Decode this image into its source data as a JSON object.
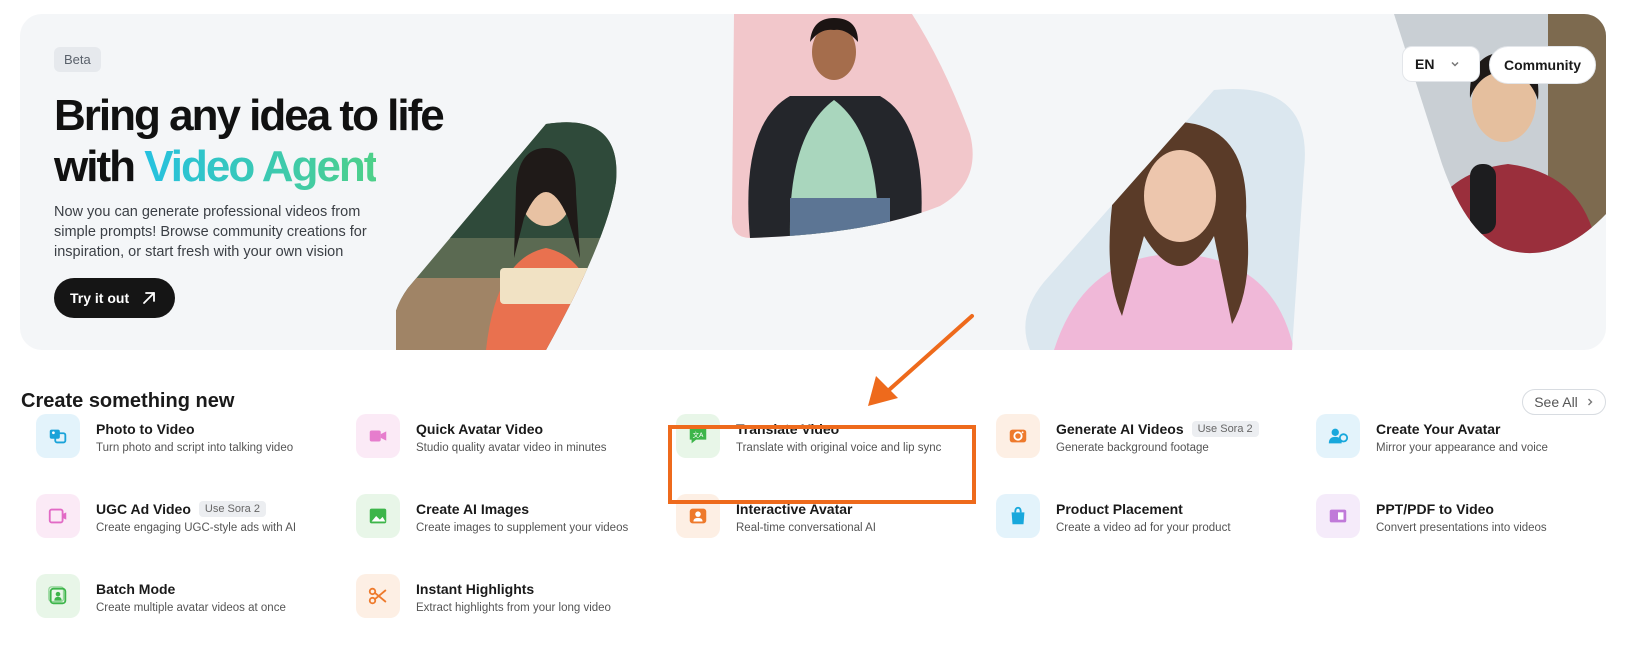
{
  "hero": {
    "badge": "Beta",
    "headline_line1": "Bring any idea to life",
    "headline_line2_prefix": "with ",
    "headline_line2_accent": "Video Agent",
    "description": "Now you can generate professional videos from simple prompts! Browse community creations for inspiration, or start fresh with your own vision",
    "cta_label": "Try it out"
  },
  "header": {
    "language": "EN",
    "community_label": "Community"
  },
  "section": {
    "title": "Create something new",
    "see_all_label": "See All"
  },
  "tools": [
    {
      "title": "Photo to Video",
      "desc": "Turn photo and script into talking video",
      "badge": "",
      "icon": "photo-to-video-icon",
      "bg": "#e3f3fb",
      "color": "#1aa3d9"
    },
    {
      "title": "Quick Avatar Video",
      "desc": "Studio quality avatar video in minutes",
      "badge": "",
      "icon": "camera-icon",
      "bg": "#fbeaf6",
      "color": "#e26ac5"
    },
    {
      "title": "Translate Video",
      "desc": "Translate with original voice and lip sync",
      "badge": "",
      "icon": "translate-icon",
      "bg": "#e8f6e8",
      "color": "#3db54a"
    },
    {
      "title": "Generate AI Videos",
      "desc": "Generate background footage",
      "badge": "Use Sora 2",
      "icon": "ai-video-icon",
      "bg": "#fdefe4",
      "color": "#ee7a2c"
    },
    {
      "title": "Create Your Avatar",
      "desc": "Mirror your appearance and voice",
      "badge": "",
      "icon": "avatar-icon",
      "bg": "#e3f3fb",
      "color": "#18a8dc"
    },
    {
      "title": "UGC Ad Video",
      "desc": "Create engaging UGC-style ads with AI",
      "badge": "Use Sora 2",
      "icon": "ugc-video-icon",
      "bg": "#fbeaf6",
      "color": "#e26ac5"
    },
    {
      "title": "Create AI Images",
      "desc": "Create images to supplement your videos",
      "badge": "",
      "icon": "image-icon",
      "bg": "#e8f6e8",
      "color": "#3db54a"
    },
    {
      "title": "Interactive Avatar",
      "desc": "Real-time conversational AI",
      "badge": "",
      "icon": "interactive-avatar-icon",
      "bg": "#fdefe4",
      "color": "#ee7a2c"
    },
    {
      "title": "Product Placement",
      "desc": "Create a video ad for your product",
      "badge": "",
      "icon": "shopping-bag-icon",
      "bg": "#e3f3fb",
      "color": "#18a8dc"
    },
    {
      "title": "PPT/PDF to Video",
      "desc": "Convert presentations into videos",
      "badge": "",
      "icon": "presentation-icon",
      "bg": "#f5ebfa",
      "color": "#c07ad9"
    },
    {
      "title": "Batch Mode",
      "desc": "Create multiple avatar videos at once",
      "badge": "",
      "icon": "batch-icon",
      "bg": "#e8f6e8",
      "color": "#3db54a"
    },
    {
      "title": "Instant Highlights",
      "desc": "Extract highlights from your long video",
      "badge": "",
      "icon": "scissors-icon",
      "bg": "#fdefe4",
      "color": "#ee7a2c"
    }
  ],
  "colors": {
    "highlight": "#ee6a1c",
    "accent_start": "#26c1e0",
    "accent_end": "#4ed089"
  }
}
